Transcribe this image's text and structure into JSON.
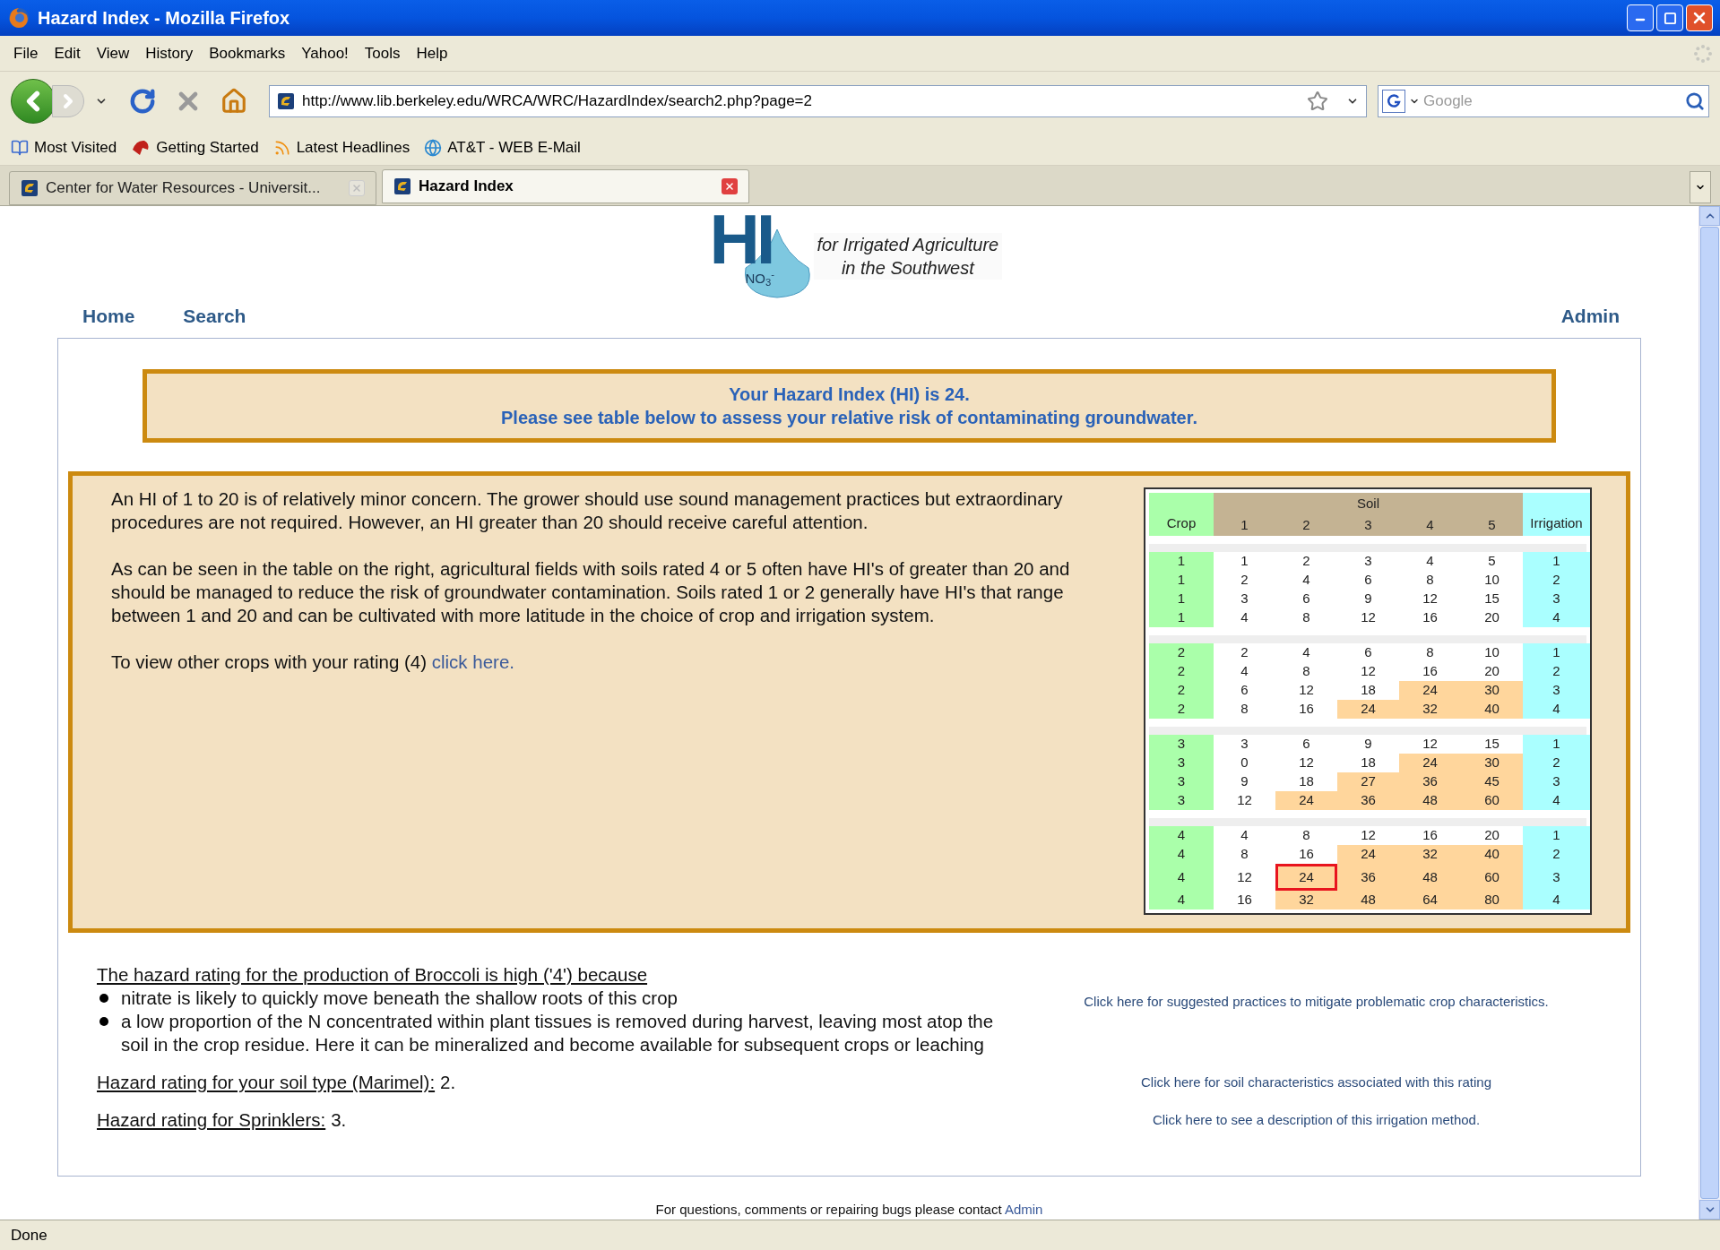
{
  "window": {
    "title": "Hazard Index - Mozilla Firefox"
  },
  "menu": [
    "File",
    "Edit",
    "View",
    "History",
    "Bookmarks",
    "Yahoo!",
    "Tools",
    "Help"
  ],
  "address_bar": {
    "url": "http://www.lib.berkeley.edu/WRCA/WRC/HazardIndex/search2.php?page=2"
  },
  "search_box": {
    "placeholder": "Google"
  },
  "bookmarks": [
    "Most Visited",
    "Getting Started",
    "Latest Headlines",
    "AT&T - WEB E-Mail"
  ],
  "tabs": [
    {
      "label": "Center for Water Resources - Universit...",
      "selected": false
    },
    {
      "label": "Hazard Index",
      "selected": true
    }
  ],
  "logo": {
    "mark": "HI",
    "formula": "NO$_{3}$$^{-}$",
    "tagline": [
      "for Irrigated Agriculture",
      "in the Southwest"
    ]
  },
  "nav": {
    "left": [
      "Home",
      "Search"
    ],
    "right": "Admin"
  },
  "banner": [
    "Your Hazard Index (HI) is 24.",
    "Please see table below to assess your relative risk of contaminating groundwater."
  ],
  "explanation": {
    "paragraphs": [
      "An HI of 1 to 20 is of relatively minor concern. The grower should use sound management practices but extraordinary procedures are not required. However, an HI greater than 20 should receive careful attention.",
      "As can be seen in the table on the right, agricultural fields with soils rated 4 or 5 often have HI's of greater than 20 and should be managed to reduce the risk of groundwater contamination. Soils rated 1 or 2 generally have HI's that range between 1 and 20 and can be cultivated with more latitude in the choice of crop and irrigation system."
    ],
    "rating_prompt": "To view other crops with your rating (4)",
    "rating_link": "click here."
  },
  "risk_table": {
    "group_heading": "Soil",
    "columns": [
      "Crop",
      "1",
      "2",
      "3",
      "4",
      "5",
      "Irrigation"
    ],
    "groups": [
      {
        "rows": [
          {
            "crop": "1",
            "cells": [
              "1",
              "2",
              "3",
              "4",
              "5"
            ],
            "shaded": [
              false,
              false,
              false,
              false,
              false
            ],
            "marked": [
              false,
              false,
              false,
              false,
              false
            ],
            "irrigation": "1"
          },
          {
            "crop": "1",
            "cells": [
              "2",
              "4",
              "6",
              "8",
              "10"
            ],
            "shaded": [
              false,
              false,
              false,
              false,
              false
            ],
            "marked": [
              false,
              false,
              false,
              false,
              false
            ],
            "irrigation": "2"
          },
          {
            "crop": "1",
            "cells": [
              "3",
              "6",
              "9",
              "12",
              "15"
            ],
            "shaded": [
              false,
              false,
              false,
              false,
              false
            ],
            "marked": [
              false,
              false,
              false,
              false,
              false
            ],
            "irrigation": "3"
          },
          {
            "crop": "1",
            "cells": [
              "4",
              "8",
              "12",
              "16",
              "20"
            ],
            "shaded": [
              false,
              false,
              false,
              false,
              false
            ],
            "marked": [
              false,
              false,
              false,
              false,
              false
            ],
            "irrigation": "4"
          }
        ]
      },
      {
        "rows": [
          {
            "crop": "2",
            "cells": [
              "2",
              "4",
              "6",
              "8",
              "10"
            ],
            "shaded": [
              false,
              false,
              false,
              false,
              false
            ],
            "marked": [
              false,
              false,
              false,
              false,
              false
            ],
            "irrigation": "1"
          },
          {
            "crop": "2",
            "cells": [
              "4",
              "8",
              "12",
              "16",
              "20"
            ],
            "shaded": [
              false,
              false,
              false,
              false,
              false
            ],
            "marked": [
              false,
              false,
              false,
              false,
              false
            ],
            "irrigation": "2"
          },
          {
            "crop": "2",
            "cells": [
              "6",
              "12",
              "18",
              "24",
              "30"
            ],
            "shaded": [
              false,
              false,
              false,
              true,
              true
            ],
            "marked": [
              false,
              false,
              false,
              false,
              false
            ],
            "irrigation": "3"
          },
          {
            "crop": "2",
            "cells": [
              "8",
              "16",
              "24",
              "32",
              "40"
            ],
            "shaded": [
              false,
              false,
              true,
              true,
              true
            ],
            "marked": [
              false,
              false,
              false,
              false,
              false
            ],
            "irrigation": "4"
          }
        ]
      },
      {
        "rows": [
          {
            "crop": "3",
            "cells": [
              "3",
              "6",
              "9",
              "12",
              "15"
            ],
            "shaded": [
              false,
              false,
              false,
              false,
              false
            ],
            "marked": [
              false,
              false,
              false,
              false,
              false
            ],
            "irrigation": "1"
          },
          {
            "crop": "3",
            "cells": [
              "0",
              "12",
              "18",
              "24",
              "30"
            ],
            "shaded": [
              false,
              false,
              false,
              true,
              true
            ],
            "marked": [
              false,
              false,
              false,
              false,
              false
            ],
            "irrigation": "2"
          },
          {
            "crop": "3",
            "cells": [
              "9",
              "18",
              "27",
              "36",
              "45"
            ],
            "shaded": [
              false,
              false,
              true,
              true,
              true
            ],
            "marked": [
              false,
              false,
              false,
              false,
              false
            ],
            "irrigation": "3"
          },
          {
            "crop": "3",
            "cells": [
              "12",
              "24",
              "36",
              "48",
              "60"
            ],
            "shaded": [
              false,
              true,
              true,
              true,
              true
            ],
            "marked": [
              false,
              false,
              false,
              false,
              false
            ],
            "irrigation": "4"
          }
        ]
      },
      {
        "rows": [
          {
            "crop": "4",
            "cells": [
              "4",
              "8",
              "12",
              "16",
              "20"
            ],
            "shaded": [
              false,
              false,
              false,
              false,
              false
            ],
            "marked": [
              false,
              false,
              false,
              false,
              false
            ],
            "irrigation": "1"
          },
          {
            "crop": "4",
            "cells": [
              "8",
              "16",
              "24",
              "32",
              "40"
            ],
            "shaded": [
              false,
              false,
              true,
              true,
              true
            ],
            "marked": [
              false,
              false,
              false,
              false,
              false
            ],
            "irrigation": "2"
          },
          {
            "crop": "4",
            "cells": [
              "12",
              "24",
              "36",
              "48",
              "60"
            ],
            "shaded": [
              false,
              true,
              true,
              true,
              true
            ],
            "marked": [
              false,
              true,
              false,
              false,
              false
            ],
            "irrigation": "3"
          },
          {
            "crop": "4",
            "cells": [
              "16",
              "32",
              "48",
              "64",
              "80"
            ],
            "shaded": [
              false,
              true,
              true,
              true,
              true
            ],
            "marked": [
              false,
              false,
              false,
              false,
              false
            ],
            "irrigation": "4"
          }
        ]
      }
    ]
  },
  "crop_detail": {
    "heading": "The hazard rating for the production of Broccoli is high ('4') because",
    "reasons": [
      "nitrate is likely to quickly move beneath the shallow roots of this crop",
      "a low proportion of the N concentrated within plant tissues is removed during harvest, leaving most atop the soil in the crop residue. Here it can be mineralized and become available for subsequent crops or leaching"
    ],
    "link": "Click here for suggested practices to mitigate problematic crop characteristics."
  },
  "ratings": [
    {
      "label": "Hazard rating for your soil type (Marimel):",
      "value": "2.",
      "link": "Click here for soil characteristics associated with this rating"
    },
    {
      "label": "Hazard rating for Sprinklers:",
      "value": "3.",
      "link": "Click here to see a description of this irrigation method."
    }
  ],
  "footer": {
    "text": "For questions, comments or repairing bugs please contact",
    "link": "Admin"
  },
  "status_bar": "Done"
}
